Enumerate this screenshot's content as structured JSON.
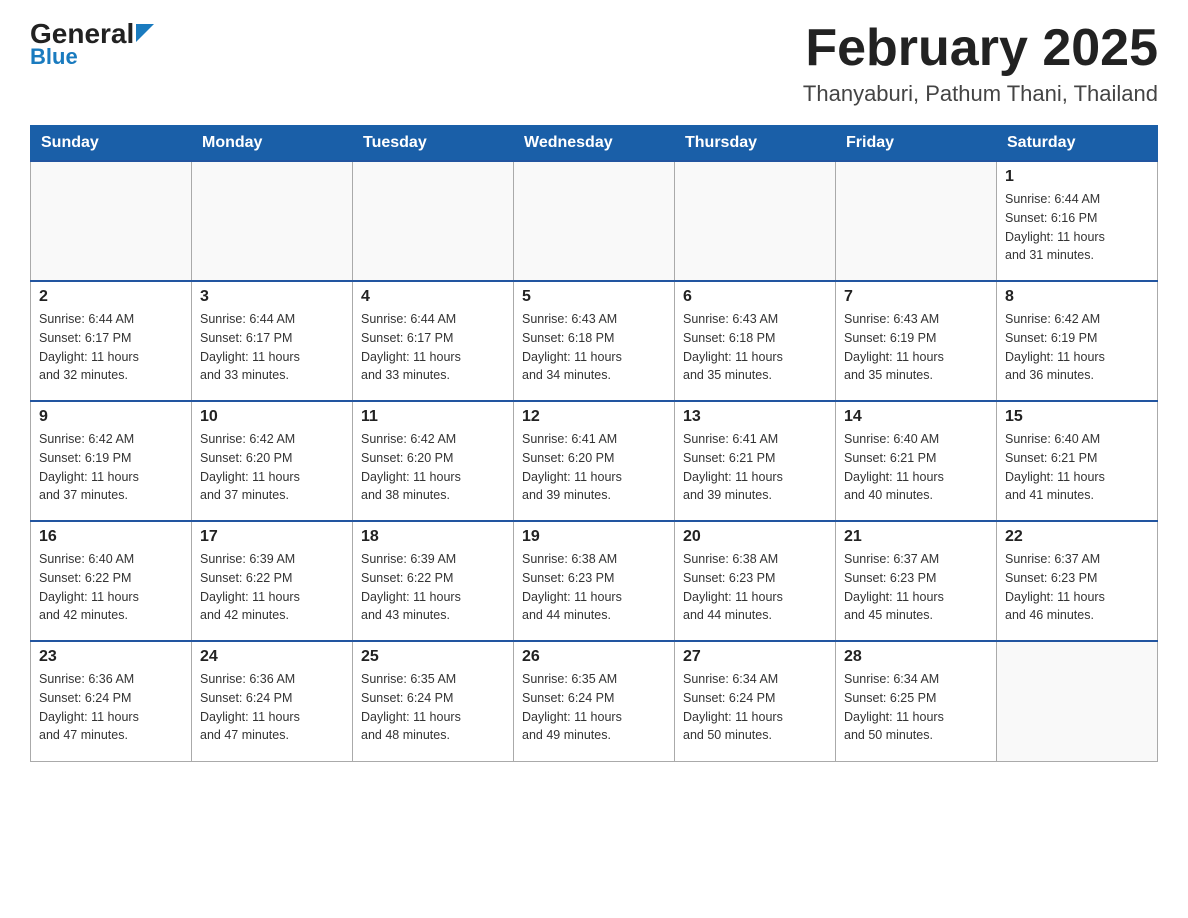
{
  "header": {
    "logo_general": "General",
    "logo_blue": "Blue",
    "title": "February 2025",
    "subtitle": "Thanyaburi, Pathum Thani, Thailand"
  },
  "weekdays": [
    "Sunday",
    "Monday",
    "Tuesday",
    "Wednesday",
    "Thursday",
    "Friday",
    "Saturday"
  ],
  "weeks": [
    [
      {
        "day": "",
        "info": ""
      },
      {
        "day": "",
        "info": ""
      },
      {
        "day": "",
        "info": ""
      },
      {
        "day": "",
        "info": ""
      },
      {
        "day": "",
        "info": ""
      },
      {
        "day": "",
        "info": ""
      },
      {
        "day": "1",
        "info": "Sunrise: 6:44 AM\nSunset: 6:16 PM\nDaylight: 11 hours\nand 31 minutes."
      }
    ],
    [
      {
        "day": "2",
        "info": "Sunrise: 6:44 AM\nSunset: 6:17 PM\nDaylight: 11 hours\nand 32 minutes."
      },
      {
        "day": "3",
        "info": "Sunrise: 6:44 AM\nSunset: 6:17 PM\nDaylight: 11 hours\nand 33 minutes."
      },
      {
        "day": "4",
        "info": "Sunrise: 6:44 AM\nSunset: 6:17 PM\nDaylight: 11 hours\nand 33 minutes."
      },
      {
        "day": "5",
        "info": "Sunrise: 6:43 AM\nSunset: 6:18 PM\nDaylight: 11 hours\nand 34 minutes."
      },
      {
        "day": "6",
        "info": "Sunrise: 6:43 AM\nSunset: 6:18 PM\nDaylight: 11 hours\nand 35 minutes."
      },
      {
        "day": "7",
        "info": "Sunrise: 6:43 AM\nSunset: 6:19 PM\nDaylight: 11 hours\nand 35 minutes."
      },
      {
        "day": "8",
        "info": "Sunrise: 6:42 AM\nSunset: 6:19 PM\nDaylight: 11 hours\nand 36 minutes."
      }
    ],
    [
      {
        "day": "9",
        "info": "Sunrise: 6:42 AM\nSunset: 6:19 PM\nDaylight: 11 hours\nand 37 minutes."
      },
      {
        "day": "10",
        "info": "Sunrise: 6:42 AM\nSunset: 6:20 PM\nDaylight: 11 hours\nand 37 minutes."
      },
      {
        "day": "11",
        "info": "Sunrise: 6:42 AM\nSunset: 6:20 PM\nDaylight: 11 hours\nand 38 minutes."
      },
      {
        "day": "12",
        "info": "Sunrise: 6:41 AM\nSunset: 6:20 PM\nDaylight: 11 hours\nand 39 minutes."
      },
      {
        "day": "13",
        "info": "Sunrise: 6:41 AM\nSunset: 6:21 PM\nDaylight: 11 hours\nand 39 minutes."
      },
      {
        "day": "14",
        "info": "Sunrise: 6:40 AM\nSunset: 6:21 PM\nDaylight: 11 hours\nand 40 minutes."
      },
      {
        "day": "15",
        "info": "Sunrise: 6:40 AM\nSunset: 6:21 PM\nDaylight: 11 hours\nand 41 minutes."
      }
    ],
    [
      {
        "day": "16",
        "info": "Sunrise: 6:40 AM\nSunset: 6:22 PM\nDaylight: 11 hours\nand 42 minutes."
      },
      {
        "day": "17",
        "info": "Sunrise: 6:39 AM\nSunset: 6:22 PM\nDaylight: 11 hours\nand 42 minutes."
      },
      {
        "day": "18",
        "info": "Sunrise: 6:39 AM\nSunset: 6:22 PM\nDaylight: 11 hours\nand 43 minutes."
      },
      {
        "day": "19",
        "info": "Sunrise: 6:38 AM\nSunset: 6:23 PM\nDaylight: 11 hours\nand 44 minutes."
      },
      {
        "day": "20",
        "info": "Sunrise: 6:38 AM\nSunset: 6:23 PM\nDaylight: 11 hours\nand 44 minutes."
      },
      {
        "day": "21",
        "info": "Sunrise: 6:37 AM\nSunset: 6:23 PM\nDaylight: 11 hours\nand 45 minutes."
      },
      {
        "day": "22",
        "info": "Sunrise: 6:37 AM\nSunset: 6:23 PM\nDaylight: 11 hours\nand 46 minutes."
      }
    ],
    [
      {
        "day": "23",
        "info": "Sunrise: 6:36 AM\nSunset: 6:24 PM\nDaylight: 11 hours\nand 47 minutes."
      },
      {
        "day": "24",
        "info": "Sunrise: 6:36 AM\nSunset: 6:24 PM\nDaylight: 11 hours\nand 47 minutes."
      },
      {
        "day": "25",
        "info": "Sunrise: 6:35 AM\nSunset: 6:24 PM\nDaylight: 11 hours\nand 48 minutes."
      },
      {
        "day": "26",
        "info": "Sunrise: 6:35 AM\nSunset: 6:24 PM\nDaylight: 11 hours\nand 49 minutes."
      },
      {
        "day": "27",
        "info": "Sunrise: 6:34 AM\nSunset: 6:24 PM\nDaylight: 11 hours\nand 50 minutes."
      },
      {
        "day": "28",
        "info": "Sunrise: 6:34 AM\nSunset: 6:25 PM\nDaylight: 11 hours\nand 50 minutes."
      },
      {
        "day": "",
        "info": ""
      }
    ]
  ]
}
